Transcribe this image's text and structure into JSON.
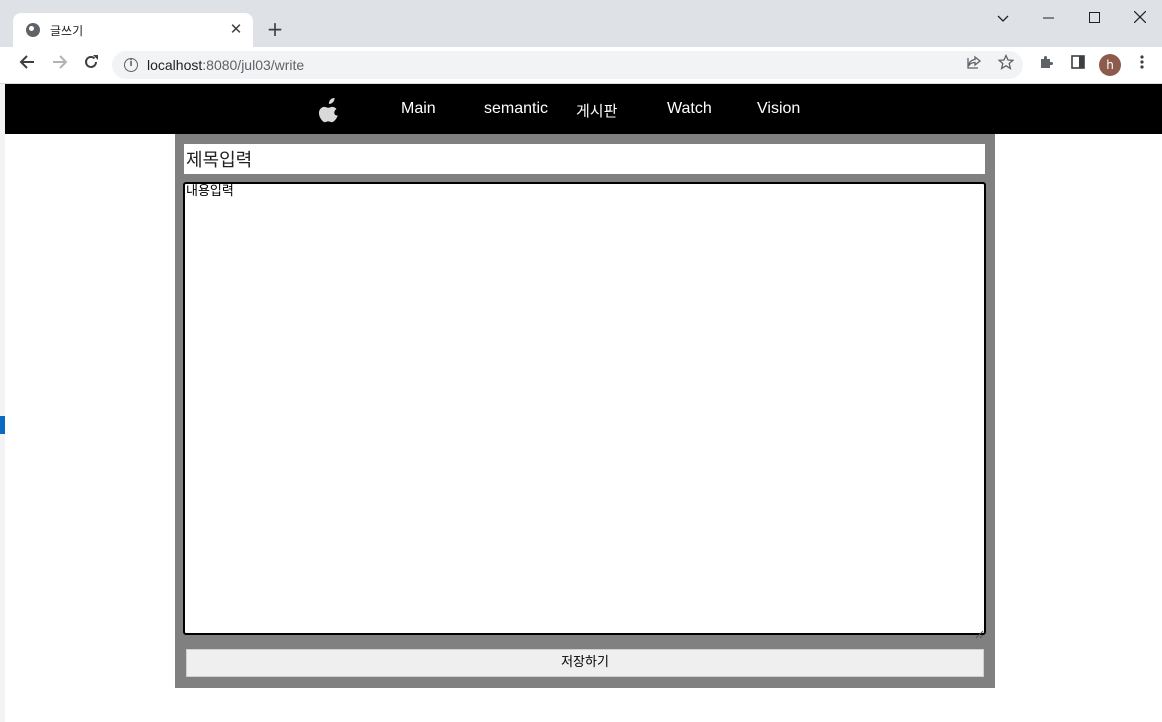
{
  "browser": {
    "tab_title": "글쓰기",
    "url_host": "localhost",
    "url_path": ":8080/jul03/write",
    "avatar_letter": "h"
  },
  "nav": {
    "items": [
      "Main",
      "semantic",
      "게시판",
      "Watch",
      "Vision"
    ]
  },
  "form": {
    "title_value": "제목입력",
    "content_value": "내용입력",
    "save_label": "저장하기"
  },
  "colors": {
    "nav_bg": "#000000",
    "form_bg": "#808080",
    "avatar_bg": "#8d5b4c"
  },
  "icons": [
    "globe-icon",
    "close-icon",
    "plus-icon",
    "back-arrow-icon",
    "forward-arrow-icon",
    "reload-icon",
    "info-icon",
    "share-icon",
    "star-icon",
    "puzzle-icon",
    "side-panel-icon",
    "menu-icon",
    "apple-logo-icon"
  ]
}
